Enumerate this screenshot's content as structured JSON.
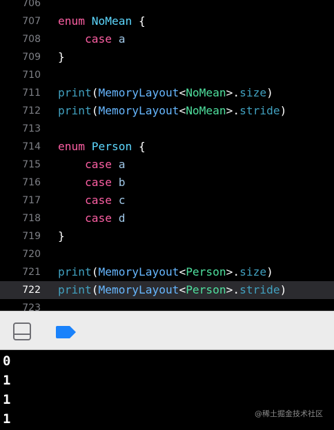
{
  "editor": {
    "current_line": "722",
    "lines": [
      {
        "n": "706",
        "tokens": []
      },
      {
        "n": "707",
        "tokens": [
          [
            "kw",
            "enum"
          ],
          [
            "pl",
            " "
          ],
          [
            "ty",
            "NoMean"
          ],
          [
            "pl",
            " {"
          ]
        ]
      },
      {
        "n": "708",
        "tokens": [
          [
            "pl",
            "    "
          ],
          [
            "kw",
            "case"
          ],
          [
            "pl",
            " "
          ],
          [
            "num",
            "a"
          ]
        ]
      },
      {
        "n": "709",
        "tokens": [
          [
            "pl",
            "}"
          ]
        ]
      },
      {
        "n": "710",
        "tokens": []
      },
      {
        "n": "711",
        "tokens": [
          [
            "fn",
            "print"
          ],
          [
            "pl",
            "("
          ],
          [
            "cls",
            "MemoryLayout"
          ],
          [
            "pl",
            "<"
          ],
          [
            "gen",
            "NoMean"
          ],
          [
            "pl",
            ">."
          ],
          [
            "fn",
            "size"
          ],
          [
            "pl",
            ")"
          ]
        ]
      },
      {
        "n": "712",
        "tokens": [
          [
            "fn",
            "print"
          ],
          [
            "pl",
            "("
          ],
          [
            "cls",
            "MemoryLayout"
          ],
          [
            "pl",
            "<"
          ],
          [
            "gen",
            "NoMean"
          ],
          [
            "pl",
            ">."
          ],
          [
            "fn",
            "stride"
          ],
          [
            "pl",
            ")"
          ]
        ]
      },
      {
        "n": "713",
        "tokens": []
      },
      {
        "n": "714",
        "tokens": [
          [
            "kw",
            "enum"
          ],
          [
            "pl",
            " "
          ],
          [
            "ty",
            "Person"
          ],
          [
            "pl",
            " {"
          ]
        ]
      },
      {
        "n": "715",
        "tokens": [
          [
            "pl",
            "    "
          ],
          [
            "kw",
            "case"
          ],
          [
            "pl",
            " "
          ],
          [
            "num",
            "a"
          ]
        ]
      },
      {
        "n": "716",
        "tokens": [
          [
            "pl",
            "    "
          ],
          [
            "kw",
            "case"
          ],
          [
            "pl",
            " "
          ],
          [
            "num",
            "b"
          ]
        ]
      },
      {
        "n": "717",
        "tokens": [
          [
            "pl",
            "    "
          ],
          [
            "kw",
            "case"
          ],
          [
            "pl",
            " "
          ],
          [
            "num",
            "c"
          ]
        ]
      },
      {
        "n": "718",
        "tokens": [
          [
            "pl",
            "    "
          ],
          [
            "kw",
            "case"
          ],
          [
            "pl",
            " "
          ],
          [
            "num",
            "d"
          ]
        ]
      },
      {
        "n": "719",
        "tokens": [
          [
            "pl",
            "}"
          ]
        ]
      },
      {
        "n": "720",
        "tokens": []
      },
      {
        "n": "721",
        "tokens": [
          [
            "fn",
            "print"
          ],
          [
            "pl",
            "("
          ],
          [
            "cls",
            "MemoryLayout"
          ],
          [
            "pl",
            "<"
          ],
          [
            "gen",
            "Person"
          ],
          [
            "pl",
            ">."
          ],
          [
            "fn",
            "size"
          ],
          [
            "pl",
            ")"
          ]
        ]
      },
      {
        "n": "722",
        "tokens": [
          [
            "fn",
            "print"
          ],
          [
            "pl",
            "("
          ],
          [
            "cls",
            "MemoryLayout"
          ],
          [
            "pl",
            "<"
          ],
          [
            "gen",
            "Person"
          ],
          [
            "pl",
            ">."
          ],
          [
            "fn",
            "stride"
          ],
          [
            "pl",
            ")"
          ]
        ]
      },
      {
        "n": "723",
        "tokens": []
      }
    ]
  },
  "toolbar": {
    "icons": [
      "toggle-debug-area-icon",
      "breakpoint-icon"
    ],
    "accent": "#1a82fb"
  },
  "console": {
    "output": [
      "0",
      "1",
      "1",
      "1"
    ]
  },
  "watermark": "@稀土掘金技术社区"
}
